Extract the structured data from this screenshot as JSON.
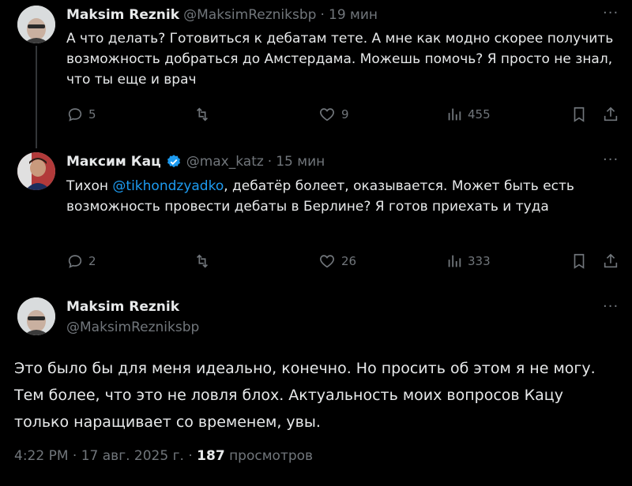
{
  "tweets": [
    {
      "author": "Maksim Reznik",
      "handle": "@MaksimRezniksbp",
      "time": "19 мин",
      "text": "А что делать? Готовиться к дебатам тете. А мне как модно скорее получить возможность добраться до Амстердама. Можешь помочь? Я просто не знал, что ты еще и врач",
      "replies": "5",
      "likes": "9",
      "views": "455",
      "more": "···"
    },
    {
      "author": "Максим Кац",
      "handle": "@max_katz",
      "time": "15 мин",
      "text_prefix": "Тихон ",
      "mention": "@tikhondzyadko",
      "text_suffix": ", дебатёр болеет, оказывается. Может быть есть возможность провести дебаты в Берлине? Я готов приехать и туда",
      "replies": "2",
      "likes": "26",
      "views": "333",
      "more": "···"
    }
  ],
  "main": {
    "author": "Maksim Reznik",
    "handle": "@MaksimRezniksbp",
    "more": "···",
    "text": "Это было бы для меня идеально, конечно. Но просить об этом я не могу. Тем более, что это не ловля блох. Актуальность моих вопросов Кацу только наращивает со временем, увы.",
    "time": "4:22 PM",
    "date": "17 авг. 2025 г.",
    "sep": "·",
    "views_count": "187",
    "views_label": "просмотров"
  },
  "colors": {
    "accent": "#1d9bf0",
    "muted": "#71767b",
    "text": "#e7e9ea",
    "background": "#000000"
  }
}
